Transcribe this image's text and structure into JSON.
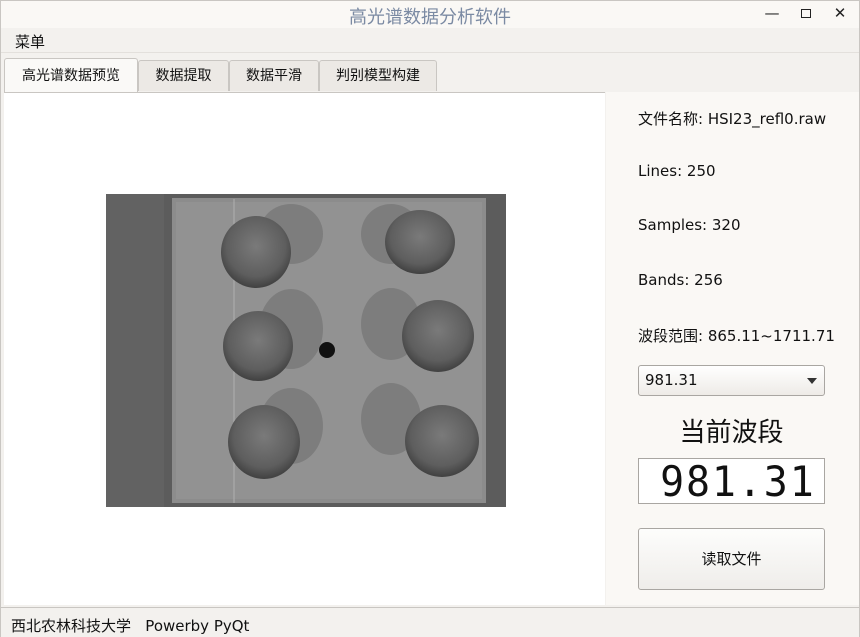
{
  "window": {
    "title": "高光谱数据分析软件",
    "minimize": "—",
    "close": "✕"
  },
  "menu": {
    "items": [
      "菜单"
    ]
  },
  "tabs": [
    "高光谱数据预览",
    "数据提取",
    "数据平滑",
    "判别模型构建"
  ],
  "active_tab": 0,
  "info": {
    "file_name": "文件名称: HSI23_refl0.raw",
    "lines": "Lines: 250",
    "samples": "Samples:  320",
    "bands": "Bands: 256",
    "range": "波段范围: 865.11~1711.71"
  },
  "band_select": {
    "value": "981.31"
  },
  "current_band": {
    "label": "当前波段",
    "value": "981.31"
  },
  "read_button": "读取文件",
  "status": {
    "text": "西北农林科技大学   Powerby PyQt"
  },
  "colors": {
    "accent_title": "#7b8aa3",
    "image_bg": "#5a5a5a"
  }
}
